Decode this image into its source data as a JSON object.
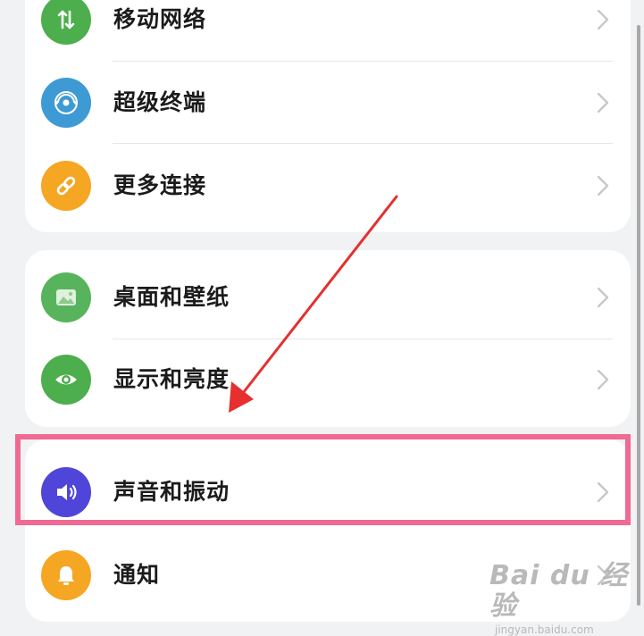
{
  "colors": {
    "mobile_network": "#4cae4c",
    "super_device": "#3d9ad4",
    "more_connections": "#f5a623",
    "desktop_wallpaper": "#58b45c",
    "display_brightness": "#4cae4c",
    "sound_vibration": "#4f45d8",
    "notifications": "#f5a623",
    "highlight_box": "#f06a93",
    "annotation_arrow": "#e62f2f"
  },
  "settings": {
    "mobile_network": {
      "label": "移动网络",
      "icon": "arrows-up-down-icon"
    },
    "super_device": {
      "label": "超级终端",
      "icon": "radar-icon"
    },
    "more_connections": {
      "label": "更多连接",
      "icon": "link-icon"
    },
    "desktop_wallpaper": {
      "label": "桌面和壁纸",
      "icon": "image-icon"
    },
    "display_brightness": {
      "label": "显示和亮度",
      "icon": "eye-icon"
    },
    "sound_vibration": {
      "label": "声音和振动",
      "icon": "speaker-icon"
    },
    "notifications": {
      "label": "通知",
      "icon": "bell-icon"
    }
  },
  "watermark": {
    "brand": "Bai du 经验",
    "url": "jingyan.baidu.com"
  }
}
